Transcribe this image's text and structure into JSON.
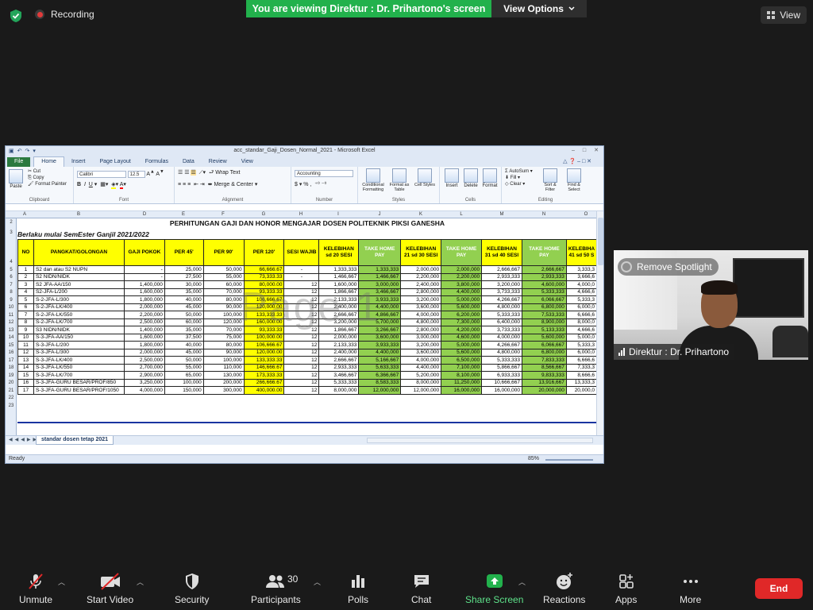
{
  "topbar": {
    "recording_label": "Recording",
    "viewing_banner": "You are viewing Direktur : Dr. Prihartono's screen",
    "view_options": "View Options",
    "view_label": "View",
    "banner_color": "#22b14c"
  },
  "excel": {
    "window_title": "acc_standar_Gaji_Dosen_Normal_2021 - Microsoft Excel",
    "tabs": [
      "File",
      "Home",
      "Insert",
      "Page Layout",
      "Formulas",
      "Data",
      "Review",
      "View"
    ],
    "ribbon": {
      "paste": "Paste",
      "cut": "Cut",
      "copy": "Copy",
      "format_painter": "Format Painter",
      "clipboard": "Clipboard",
      "font_name": "Calibri",
      "font_size": "12.5",
      "font_group": "Font",
      "wrap_text": "Wrap Text",
      "merge_center": "Merge & Center",
      "alignment_group": "Alignment",
      "number_format": "Accounting",
      "number_group": "Number",
      "conditional_formatting": "Conditional Formatting",
      "format_as_table": "Format as Table",
      "cell_styles": "Cell Styles",
      "styles_group": "Styles",
      "insert": "Insert",
      "delete": "Delete",
      "format": "Format",
      "cells_group": "Cells",
      "autosum": "AutoSum",
      "fill": "Fill",
      "clear": "Clear",
      "sort_filter": "Sort & Filter",
      "find_select": "Find & Select",
      "editing_group": "Editing"
    },
    "columns": [
      "A",
      "B",
      "D",
      "E",
      "F",
      "G",
      "H",
      "I",
      "J",
      "K",
      "L",
      "M",
      "N",
      "O"
    ],
    "row_numbers": [
      "2",
      "3",
      "4",
      "5",
      "6",
      "7",
      "8",
      "9",
      "10",
      "11",
      "12",
      "13",
      "14",
      "15",
      "16",
      "17",
      "18",
      "19",
      "20",
      "21",
      "22",
      "23"
    ],
    "title": "PERHITUNGAN GAJI DAN HONOR MENGAJAR DOSEN POLITEKNIK PIKSI GANESHA",
    "subtitle": "Berlaku mulai SemEster Ganjil 2021/2022",
    "headers": [
      "NO",
      "PANGKAT/GOLONGAN",
      "GAJI POKOK",
      "PER 45'",
      "PER 90'",
      "PER 120'",
      "SESI WAJIB",
      "KELEBIHAN sd 20 SESI",
      "TAKE HOME PAY",
      "KELEBIHAN 21 sd 30 SESI",
      "TAKE HOME PAY",
      "KELEBIHAN 31 sd 40 SESI",
      "TAKE HOME PAY",
      "KELEBIHA 41 sd 50 S"
    ],
    "rows": [
      [
        "1",
        "S2 dan atau S2 NUPN",
        "-",
        "25,000",
        "50,000",
        "66,666.67",
        "-",
        "1,333,333",
        "1,333,333",
        "2,000,000",
        "2,000,000",
        "2,666,667",
        "2,666,667",
        "3,333,3"
      ],
      [
        "2",
        "S2 NIDN/NIDK",
        "-",
        "27,500",
        "55,000",
        "73,333.33",
        "-",
        "1,466,667",
        "1,466,667",
        "2,200,000",
        "2,200,000",
        "2,933,333",
        "2,933,333",
        "3,666,6"
      ],
      [
        "3",
        "S2 JFA-AA/150",
        "1,400,000",
        "30,000",
        "60,000",
        "80,000.00",
        "12",
        "1,600,000",
        "3,000,000",
        "2,400,000",
        "3,800,000",
        "3,200,000",
        "4,600,000",
        "4,000,0"
      ],
      [
        "4",
        "S2-JFA-L/200",
        "1,600,000",
        "35,000",
        "70,000",
        "93,333.33",
        "12",
        "1,866,667",
        "3,466,667",
        "2,800,000",
        "4,400,000",
        "3,733,333",
        "5,333,333",
        "4,666,6"
      ],
      [
        "5",
        "S-2-JFA-L/300",
        "1,800,000",
        "40,000",
        "80,000",
        "106,666.67",
        "12",
        "2,133,333",
        "3,933,333",
        "3,200,000",
        "5,000,000",
        "4,266,667",
        "6,066,667",
        "5,333,3"
      ],
      [
        "6",
        "S-2-JFA-LK/400",
        "2,000,000",
        "45,000",
        "90,000",
        "120,000.00",
        "12",
        "2,400,000",
        "4,400,000",
        "3,600,000",
        "5,600,000",
        "4,800,000",
        "6,800,000",
        "6,000,0"
      ],
      [
        "7",
        "S-2-JFA-LK/550",
        "2,200,000",
        "50,000",
        "100,000",
        "133,333.33",
        "12",
        "2,666,667",
        "4,866,667",
        "4,000,000",
        "6,200,000",
        "5,333,333",
        "7,533,333",
        "6,666,6"
      ],
      [
        "8",
        "S-2-JFA-LK/700",
        "2,500,000",
        "60,000",
        "120,000",
        "160,000.00",
        "12",
        "3,200,000",
        "5,700,000",
        "4,800,000",
        "7,300,000",
        "6,400,000",
        "8,900,000",
        "8,000,0"
      ],
      [
        "9",
        "S3 NIDN/NIDK",
        "1,400,000",
        "35,000",
        "70,000",
        "93,333.33",
        "12",
        "1,866,667",
        "3,266,667",
        "2,800,000",
        "4,200,000",
        "3,733,333",
        "5,133,333",
        "4,666,6"
      ],
      [
        "10",
        "S-3-JFA-AA/150",
        "1,600,000",
        "37,500",
        "75,000",
        "100,000.00",
        "12",
        "2,000,000",
        "3,600,000",
        "3,000,000",
        "4,600,000",
        "4,000,000",
        "5,600,000",
        "5,000,0"
      ],
      [
        "11",
        "S-3-JFA-L/200",
        "1,800,000",
        "40,000",
        "80,000",
        "106,666.67",
        "12",
        "2,133,333",
        "3,933,333",
        "3,200,000",
        "5,000,000",
        "4,266,667",
        "6,066,667",
        "5,333,3"
      ],
      [
        "12",
        "S-3-JFA-L/300",
        "2,000,000",
        "45,000",
        "90,000",
        "120,000.00",
        "12",
        "2,400,000",
        "4,400,000",
        "3,600,000",
        "5,600,000",
        "4,800,000",
        "6,800,000",
        "6,000,0"
      ],
      [
        "13",
        "S-3-JFA-LK/400",
        "2,500,000",
        "50,000",
        "100,000",
        "133,333.33",
        "12",
        "2,666,667",
        "5,166,667",
        "4,000,000",
        "6,500,000",
        "5,333,333",
        "7,833,333",
        "6,666,6"
      ],
      [
        "14",
        "S-3-JFA-LK/550",
        "2,700,000",
        "55,000",
        "110,000",
        "146,666.67",
        "12",
        "2,933,333",
        "5,633,333",
        "4,400,000",
        "7,100,000",
        "5,866,667",
        "8,566,667",
        "7,333,3"
      ],
      [
        "15",
        "S-3-JFA-LK/700",
        "2,900,000",
        "65,000",
        "130,000",
        "173,333.33",
        "12",
        "3,466,667",
        "6,366,667",
        "5,200,000",
        "8,100,000",
        "6,933,333",
        "9,833,333",
        "8,666,6"
      ],
      [
        "16",
        "S-3-JFA-GURU BESAR/PROF/850",
        "3,250,000",
        "100,000",
        "200,000",
        "266,666.67",
        "12",
        "5,333,333",
        "8,583,333",
        "8,000,000",
        "11,250,000",
        "10,666,667",
        "13,916,667",
        "13,333,3"
      ],
      [
        "17",
        "S-3-JFA-GURU BESAR/PROF/1050",
        "4,000,000",
        "150,000",
        "300,000",
        "400,000.00",
        "12",
        "8,000,000",
        "12,000,000",
        "12,000,000",
        "16,000,000",
        "16,000,000",
        "20,000,000",
        "20,000,0"
      ]
    ],
    "watermark": "Page 1",
    "sheet_tab": "standar dosen tetap 2021",
    "status": "Ready",
    "zoom": "85%",
    "highlight_yellow": "#ffff00",
    "highlight_green": "#92d050"
  },
  "video": {
    "spotlight": "Remove Spotlight",
    "participant_name": "Direktur : Dr. Prihartono"
  },
  "toolbar": {
    "unmute": "Unmute",
    "start_video": "Start Video",
    "security": "Security",
    "participants": "Participants",
    "participants_count": "30",
    "polls": "Polls",
    "chat": "Chat",
    "share_screen": "Share Screen",
    "reactions": "Reactions",
    "apps": "Apps",
    "more": "More",
    "end": "End",
    "end_color": "#e02828",
    "share_color": "#22b14c"
  }
}
